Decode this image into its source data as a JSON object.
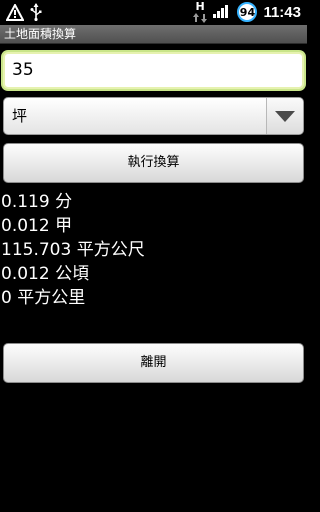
{
  "status_bar": {
    "time": "11:43",
    "battery_level": "94",
    "network_letter": "H"
  },
  "app": {
    "title": "土地面積換算"
  },
  "input": {
    "value": "35"
  },
  "unit_select": {
    "selected": "坪"
  },
  "buttons": {
    "convert_label": "執行換算",
    "leave_label": "離開"
  },
  "results": [
    "0.119 分",
    "0.012 甲",
    "115.703 平方公尺",
    "0.012 公頃",
    "0 平方公里"
  ]
}
